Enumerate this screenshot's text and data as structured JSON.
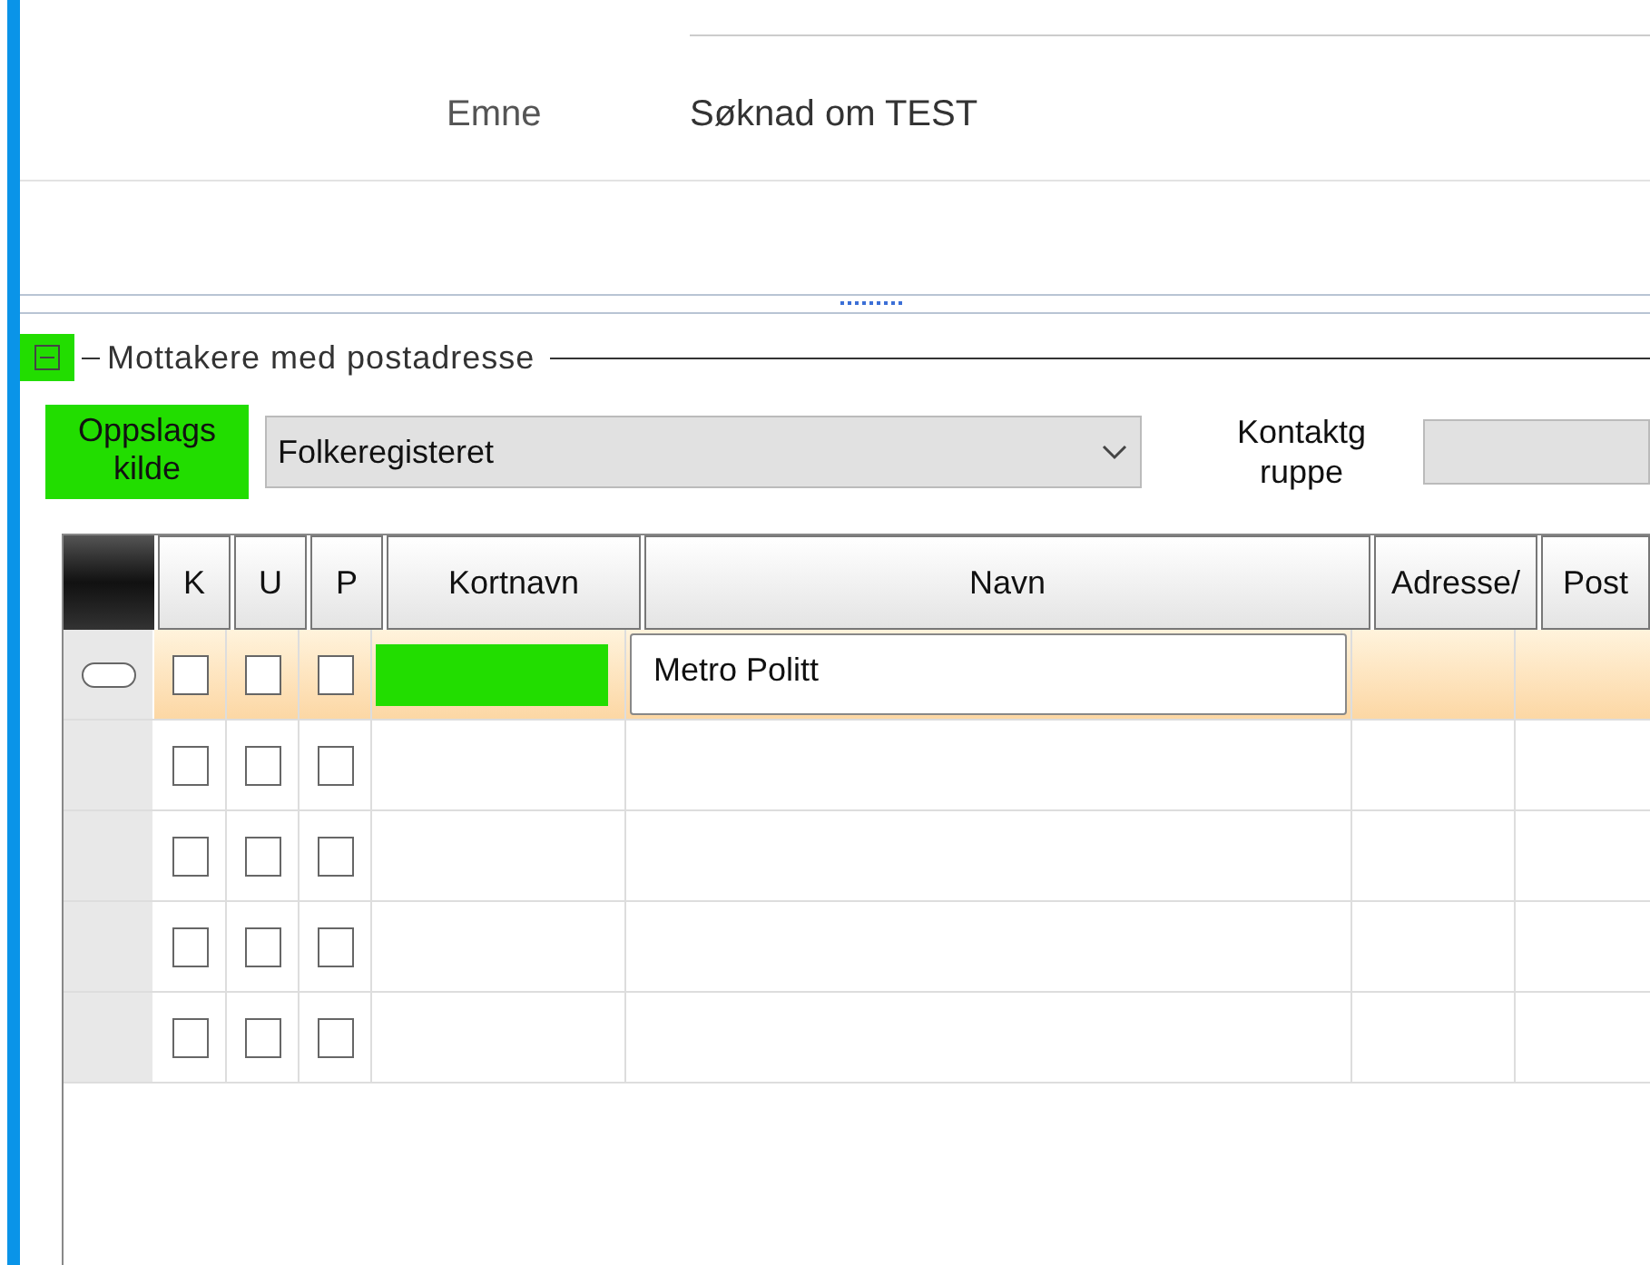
{
  "subject": {
    "label": "Emne",
    "value": "Søknad om TEST"
  },
  "group": {
    "title": "Mottakere med postadresse",
    "expanded": true
  },
  "lookup": {
    "label": "Oppslags kilde",
    "value": "Folkeregisteret"
  },
  "contact_group": {
    "label": "Kontaktg ruppe"
  },
  "table": {
    "columns": [
      "K",
      "U",
      "P",
      "Kortnavn",
      "Navn",
      "Adresse/",
      "Post"
    ],
    "rows": [
      {
        "selected": true,
        "k": false,
        "u": false,
        "p": false,
        "kortnavn_redacted": true,
        "navn": "Metro Politt"
      },
      {
        "selected": false,
        "k": false,
        "u": false,
        "p": false,
        "kortnavn_redacted": false
      },
      {
        "selected": false,
        "k": false,
        "u": false,
        "p": false,
        "kortnavn_redacted": false
      },
      {
        "selected": false,
        "k": false,
        "u": false,
        "p": false,
        "kortnavn_redacted": false
      },
      {
        "selected": false,
        "k": false,
        "u": false,
        "p": false,
        "kortnavn_redacted": false
      }
    ]
  }
}
